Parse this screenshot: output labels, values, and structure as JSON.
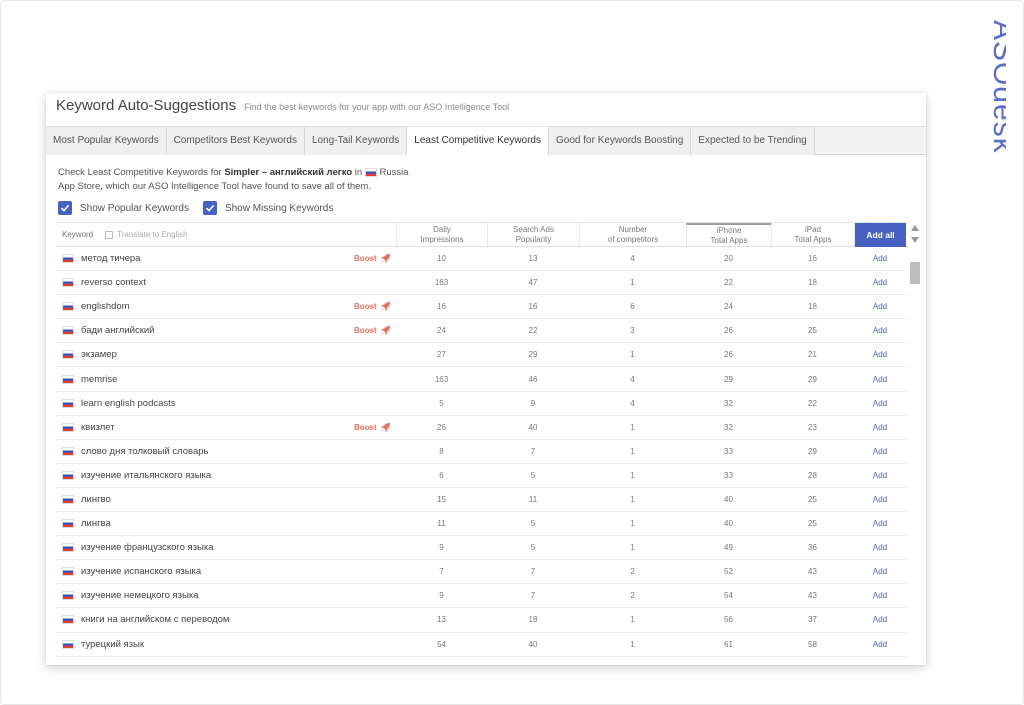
{
  "brand": {
    "logo_text": "ASOdesk"
  },
  "header": {
    "title": "Keyword Auto-Suggestions",
    "subtitle": "Find the best keywords for your app with our ASO Intelligence Tool"
  },
  "tabs": [
    {
      "label": "Most Popular Keywords",
      "active": false
    },
    {
      "label": "Competitors Best Keywords",
      "active": false
    },
    {
      "label": "Long-Tail Keywords",
      "active": false
    },
    {
      "label": "Least Competitive Keywords",
      "active": true
    },
    {
      "label": "Good for Keywords Boosting",
      "active": false
    },
    {
      "label": "Expected to be Trending",
      "active": false
    }
  ],
  "description": {
    "prefix": "Check Least Competitive Keywords for",
    "app_name": "Simpler – английский легко",
    "in": "in",
    "country": "Russia",
    "suffix": "App Store, which our ASO Intelligence Tool have found to save all of them."
  },
  "checkboxes": [
    {
      "label": "Show Popular Keywords",
      "checked": true
    },
    {
      "label": "Show Missing Keywords",
      "checked": true
    }
  ],
  "table": {
    "keyword_header": "Keyword",
    "translate_label": "Translate to English",
    "col_daily_1": "Daily",
    "col_daily_2": "Impressions",
    "col_search_1": "Search Ads",
    "col_search_2": "Popularity",
    "col_comp_1": "Number",
    "col_comp_2": "of competitors",
    "col_iphone_1": "iPhone",
    "col_iphone_2": "Total Apps",
    "col_ipad_1": "iPad",
    "col_ipad_2": "Total Apps",
    "add_all": "Add all",
    "boost_label": "Boost",
    "add_label": "Add",
    "rows": [
      {
        "keyword": "метод тичера",
        "boost": true,
        "daily": "10",
        "search": "13",
        "competitors": "4",
        "iphone": "20",
        "ipad": "16"
      },
      {
        "keyword": "reverso context",
        "boost": false,
        "daily": "163",
        "search": "47",
        "competitors": "1",
        "iphone": "22",
        "ipad": "18"
      },
      {
        "keyword": "englishdom",
        "boost": true,
        "daily": "16",
        "search": "16",
        "competitors": "6",
        "iphone": "24",
        "ipad": "18"
      },
      {
        "keyword": "бади английский",
        "boost": true,
        "daily": "24",
        "search": "22",
        "competitors": "3",
        "iphone": "26",
        "ipad": "25"
      },
      {
        "keyword": "экзамер",
        "boost": false,
        "daily": "27",
        "search": "29",
        "competitors": "1",
        "iphone": "26",
        "ipad": "21"
      },
      {
        "keyword": "memrise",
        "boost": false,
        "daily": "163",
        "search": "46",
        "competitors": "4",
        "iphone": "29",
        "ipad": "29"
      },
      {
        "keyword": "learn english podcasts",
        "boost": false,
        "daily": "5",
        "search": "9",
        "competitors": "4",
        "iphone": "32",
        "ipad": "22"
      },
      {
        "keyword": "квизлет",
        "boost": true,
        "daily": "26",
        "search": "40",
        "competitors": "1",
        "iphone": "32",
        "ipad": "23"
      },
      {
        "keyword": "слово дня толковый словарь",
        "boost": false,
        "daily": "8",
        "search": "7",
        "competitors": "1",
        "iphone": "33",
        "ipad": "29"
      },
      {
        "keyword": "изучение итальянского языка",
        "boost": false,
        "daily": "6",
        "search": "5",
        "competitors": "1",
        "iphone": "33",
        "ipad": "28"
      },
      {
        "keyword": "лингво",
        "boost": false,
        "daily": "15",
        "search": "11",
        "competitors": "1",
        "iphone": "40",
        "ipad": "25"
      },
      {
        "keyword": "лингва",
        "boost": false,
        "daily": "11",
        "search": "5",
        "competitors": "1",
        "iphone": "40",
        "ipad": "25"
      },
      {
        "keyword": "изучение французского языка",
        "boost": false,
        "daily": "9",
        "search": "5",
        "competitors": "1",
        "iphone": "49",
        "ipad": "36"
      },
      {
        "keyword": "изучение испанского языка",
        "boost": false,
        "daily": "7",
        "search": "7",
        "competitors": "2",
        "iphone": "52",
        "ipad": "43"
      },
      {
        "keyword": "изучение немецкого языка",
        "boost": false,
        "daily": "9",
        "search": "7",
        "competitors": "2",
        "iphone": "54",
        "ipad": "43"
      },
      {
        "keyword": "книги на английском с переводом",
        "boost": false,
        "daily": "13",
        "search": "18",
        "competitors": "1",
        "iphone": "56",
        "ipad": "37"
      },
      {
        "keyword": "турецкий язык",
        "boost": false,
        "daily": "54",
        "search": "40",
        "competitors": "1",
        "iphone": "61",
        "ipad": "58"
      }
    ]
  },
  "colors": {
    "accent": "#4661c2",
    "boost": "#e9735a",
    "logo": "#5a6ec7"
  }
}
